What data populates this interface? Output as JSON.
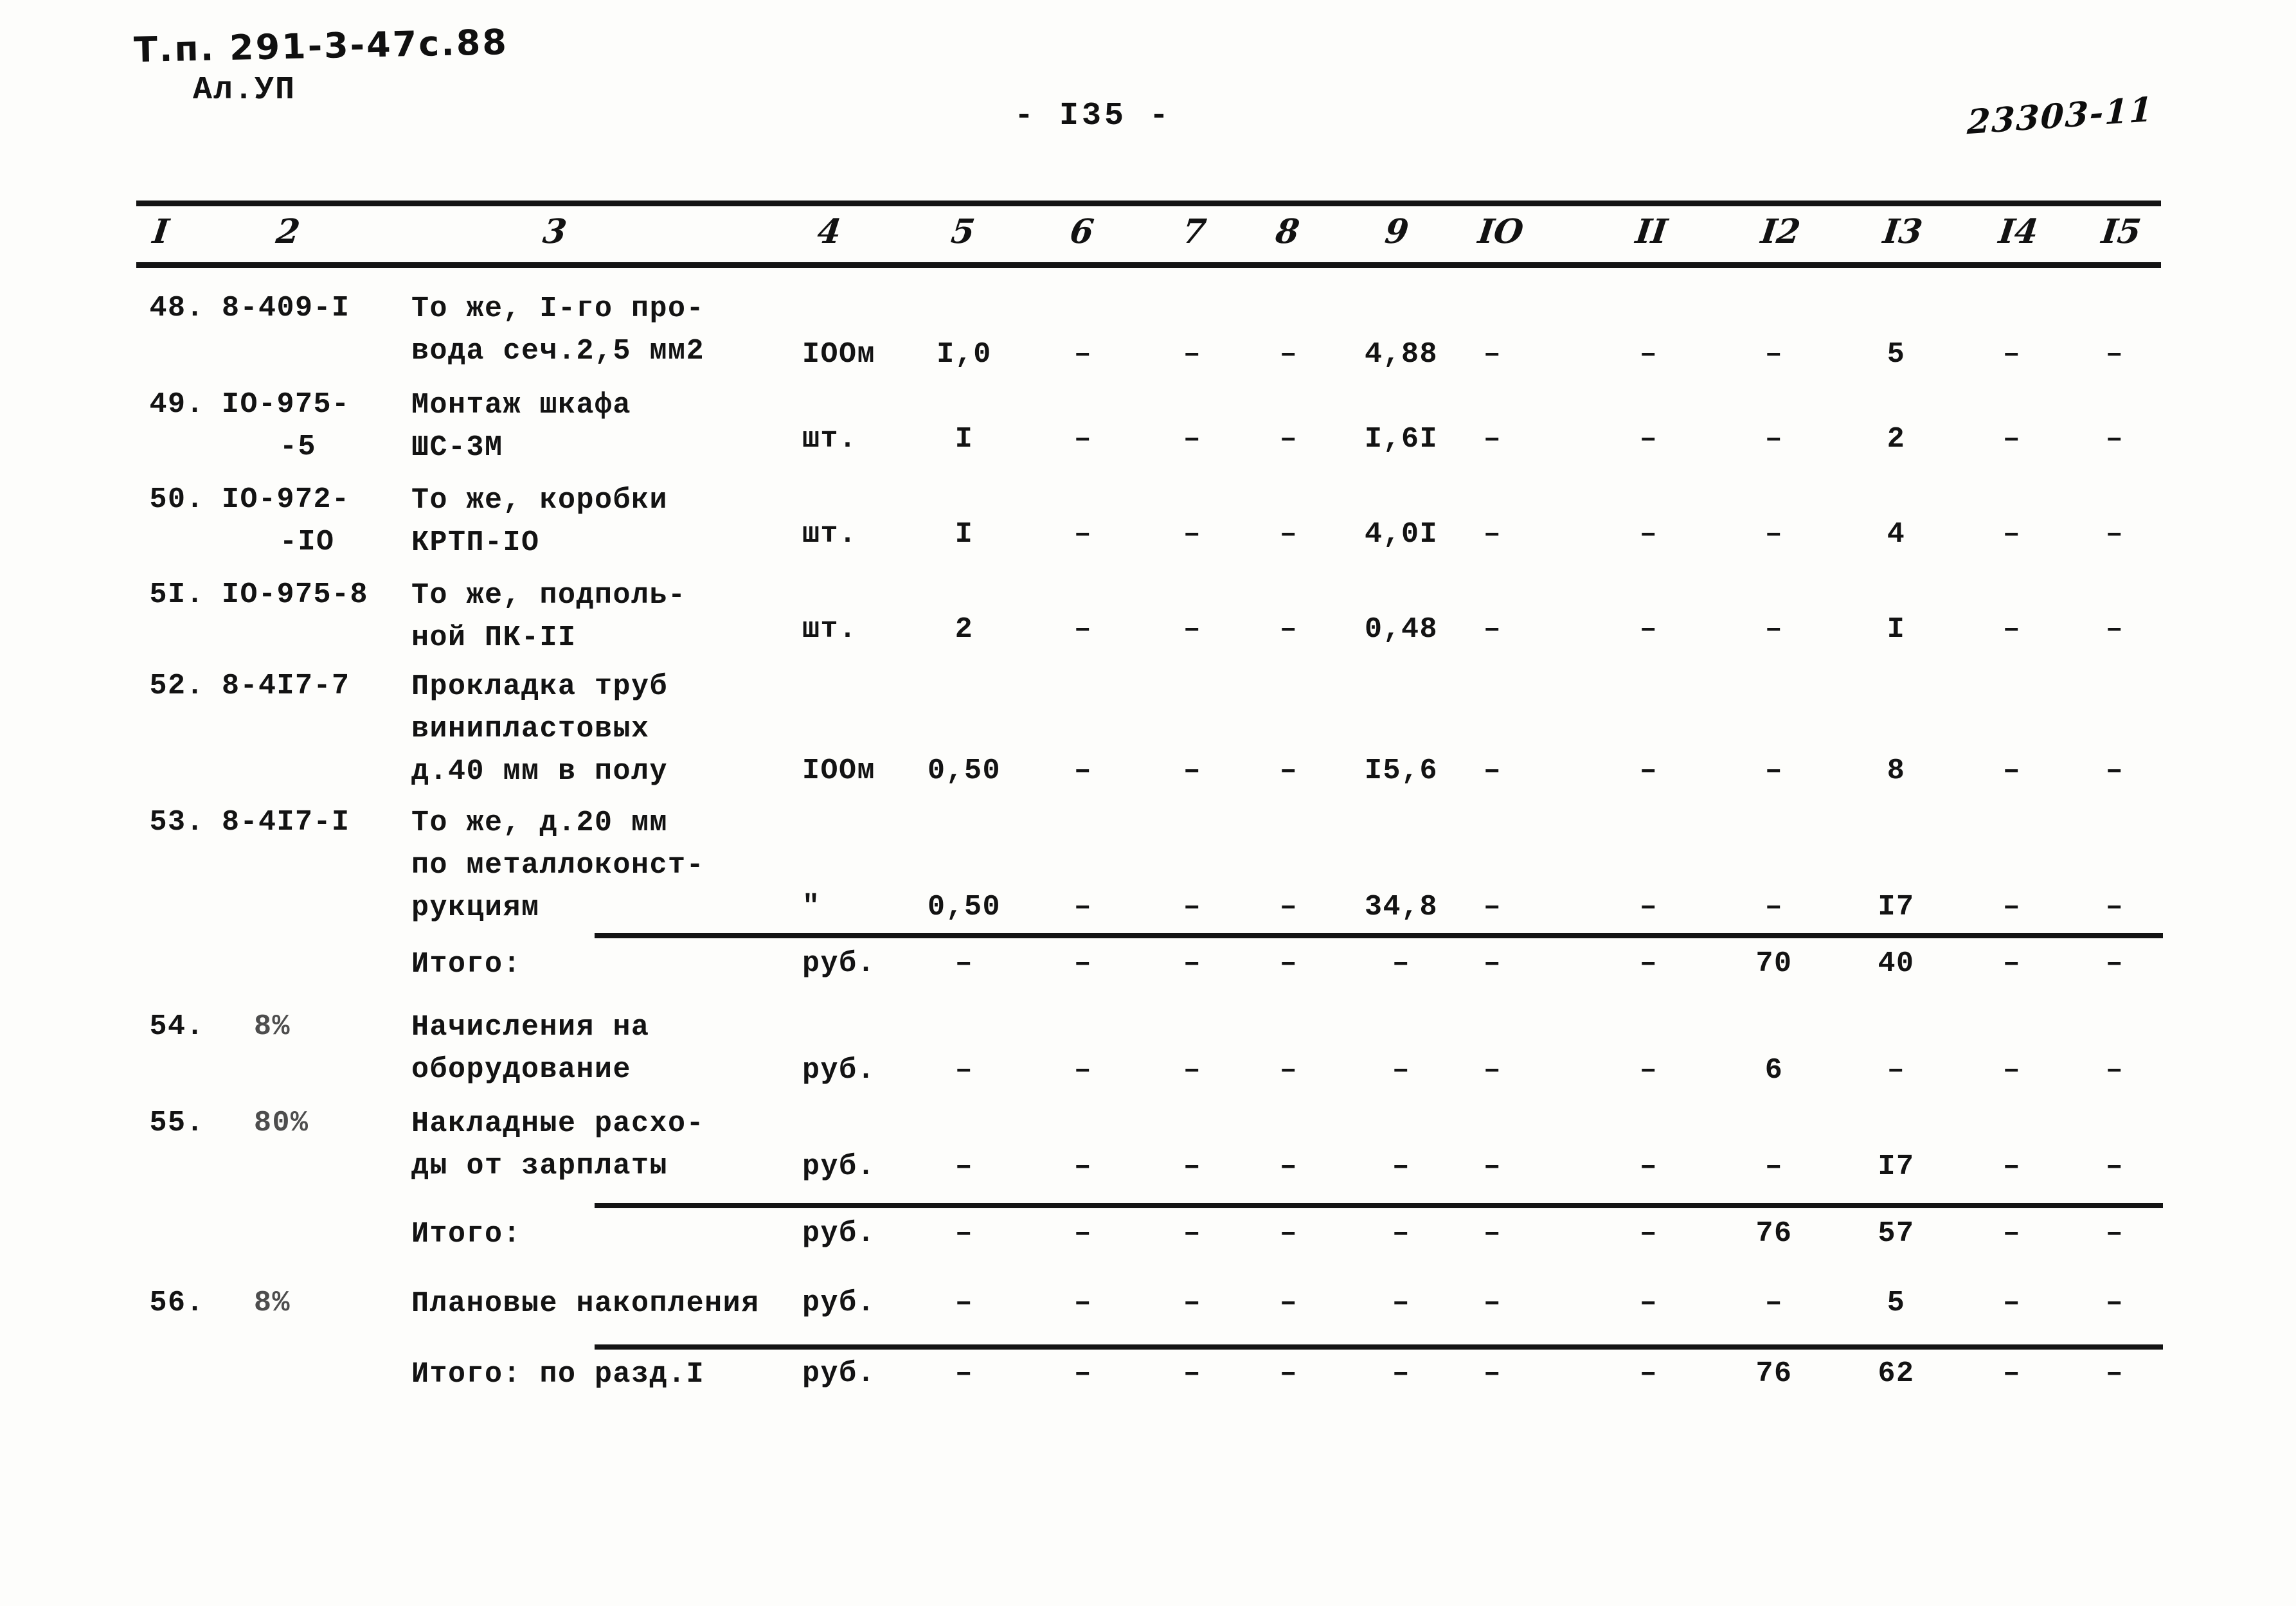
{
  "header": {
    "type_code": "Т.п. 291-3-47с.88",
    "album": "Ал.УП",
    "page_number": "- I35 -",
    "stamp": "23303-11"
  },
  "table": {
    "column_headers": [
      "I",
      "2",
      "3",
      "4",
      "5",
      "6",
      "7",
      "8",
      "9",
      "IO",
      "II",
      "I2",
      "I3",
      "I4",
      "I5"
    ],
    "rows": [
      {
        "no": "48.",
        "code": "8-409-I",
        "name_lines": [
          "То же, I-го про-",
          "вода сеч.2,5 мм2"
        ],
        "unit": "IOOм",
        "c5": "I,0",
        "c6": "–",
        "c7": "–",
        "c8": "–",
        "c9": "4,88",
        "c10": "–",
        "c11": "–",
        "c12": "–",
        "c13": "5",
        "c14": "–",
        "c15": "–"
      },
      {
        "no": "49.",
        "code": "IO-975-",
        "code2": "-5",
        "name_lines": [
          "Монтаж шкафа",
          "ШС-3М"
        ],
        "unit": "шт.",
        "c5": "I",
        "c6": "–",
        "c7": "–",
        "c8": "–",
        "c9": "I,6I",
        "c10": "–",
        "c11": "–",
        "c12": "–",
        "c13": "2",
        "c14": "–",
        "c15": "–"
      },
      {
        "no": "50.",
        "code": "IO-972-",
        "code2": "-IO",
        "name_lines": [
          "То же, коробки",
          "КРТП-IO"
        ],
        "unit": "шт.",
        "c5": "I",
        "c6": "–",
        "c7": "–",
        "c8": "–",
        "c9": "4,0I",
        "c10": "–",
        "c11": "–",
        "c12": "–",
        "c13": "4",
        "c14": "–",
        "c15": "–"
      },
      {
        "no": "5I.",
        "code": "IO-975-8",
        "name_lines": [
          "То же, подполь-",
          "ной ПК-II"
        ],
        "unit": "шт.",
        "c5": "2",
        "c6": "–",
        "c7": "–",
        "c8": "–",
        "c9": "0,48",
        "c10": "–",
        "c11": "–",
        "c12": "–",
        "c13": "I",
        "c14": "–",
        "c15": "–"
      },
      {
        "no": "52.",
        "code": "8-4I7-7",
        "name_lines": [
          "Прокладка труб",
          "винипластовых",
          "д.40 мм в полу"
        ],
        "unit": "IOOм",
        "c5": "0,50",
        "c6": "–",
        "c7": "–",
        "c8": "–",
        "c9": "I5,6",
        "c10": "–",
        "c11": "–",
        "c12": "–",
        "c13": "8",
        "c14": "–",
        "c15": "–"
      },
      {
        "no": "53.",
        "code": "8-4I7-I",
        "name_lines": [
          "То же, д.20 мм",
          "по металлоконст-",
          "рукциям"
        ],
        "unit": "\"",
        "c5": "0,50",
        "c6": "–",
        "c7": "–",
        "c8": "–",
        "c9": "34,8",
        "c10": "–",
        "c11": "–",
        "c12": "–",
        "c13": "I7",
        "c14": "–",
        "c15": "–"
      },
      {
        "no": "",
        "code": "",
        "name_lines": [
          "Итого:"
        ],
        "unit": "руб.",
        "c5": "–",
        "c6": "–",
        "c7": "–",
        "c8": "–",
        "c9": "–",
        "c10": "–",
        "c11": "–",
        "c12": "70",
        "c13": "40",
        "c14": "–",
        "c15": "–"
      },
      {
        "no": "54.",
        "code": "8%",
        "code_faded": true,
        "name_lines": [
          "Начисления на",
          "оборудование"
        ],
        "unit": "руб.",
        "c5": "–",
        "c6": "–",
        "c7": "–",
        "c8": "–",
        "c9": "–",
        "c10": "–",
        "c11": "–",
        "c12": "6",
        "c13": "–",
        "c14": "–",
        "c15": "–"
      },
      {
        "no": "55.",
        "code": "80%",
        "code_faded": true,
        "name_lines": [
          "Накладные расхо-",
          "ды от зарплаты"
        ],
        "unit": "руб.",
        "c5": "–",
        "c6": "–",
        "c7": "–",
        "c8": "–",
        "c9": "–",
        "c10": "–",
        "c11": "–",
        "c12": "–",
        "c13": "I7",
        "c14": "–",
        "c15": "–"
      },
      {
        "no": "",
        "code": "",
        "name_lines": [
          "Итого:"
        ],
        "unit": "руб.",
        "c5": "–",
        "c6": "–",
        "c7": "–",
        "c8": "–",
        "c9": "–",
        "c10": "–",
        "c11": "–",
        "c12": "76",
        "c13": "57",
        "c14": "–",
        "c15": "–"
      },
      {
        "no": "56.",
        "code": "8%",
        "code_faded": true,
        "name_lines": [
          "Плановые накопления"
        ],
        "unit": "руб.",
        "c5": "–",
        "c6": "–",
        "c7": "–",
        "c8": "–",
        "c9": "–",
        "c10": "–",
        "c11": "–",
        "c12": "–",
        "c13": "5",
        "c14": "–",
        "c15": "–"
      },
      {
        "no": "",
        "code": "",
        "name_lines": [
          "Итого: по разд.I"
        ],
        "unit": "руб.",
        "c5": "–",
        "c6": "–",
        "c7": "–",
        "c8": "–",
        "c9": "–",
        "c10": "–",
        "c11": "–",
        "c12": "76",
        "c13": "62",
        "c14": "–",
        "c15": "–"
      }
    ]
  },
  "layout": {
    "col_header_x": [
      238,
      430,
      845,
      1272,
      1480,
      1665,
      1840,
      1985,
      2155,
      2300,
      2545,
      2740,
      2930,
      3110,
      3270
    ],
    "col_x": {
      "no": 318,
      "code": 345,
      "name": 640,
      "unit": 1248,
      "c5": 1500,
      "c6": 1685,
      "c7": 1855,
      "c8": 2005,
      "c9": 2180,
      "c10": 2322,
      "c11": 2565,
      "c12": 2760,
      "c13": 2950,
      "c14": 3130,
      "c15": 3290
    },
    "rows_y": [
      462,
      612,
      760,
      908,
      1050,
      1262,
      1470,
      1580,
      1730,
      1890,
      1998,
      2108
    ],
    "row_name_y": [
      448,
      598,
      746,
      894,
      1036,
      1248,
      1468,
      1566,
      1716,
      1888,
      1996,
      2106
    ],
    "unit_y": [
      520,
      652,
      800,
      948,
      1168,
      1380,
      1468,
      1634,
      1784,
      1888,
      1996,
      2106
    ]
  }
}
